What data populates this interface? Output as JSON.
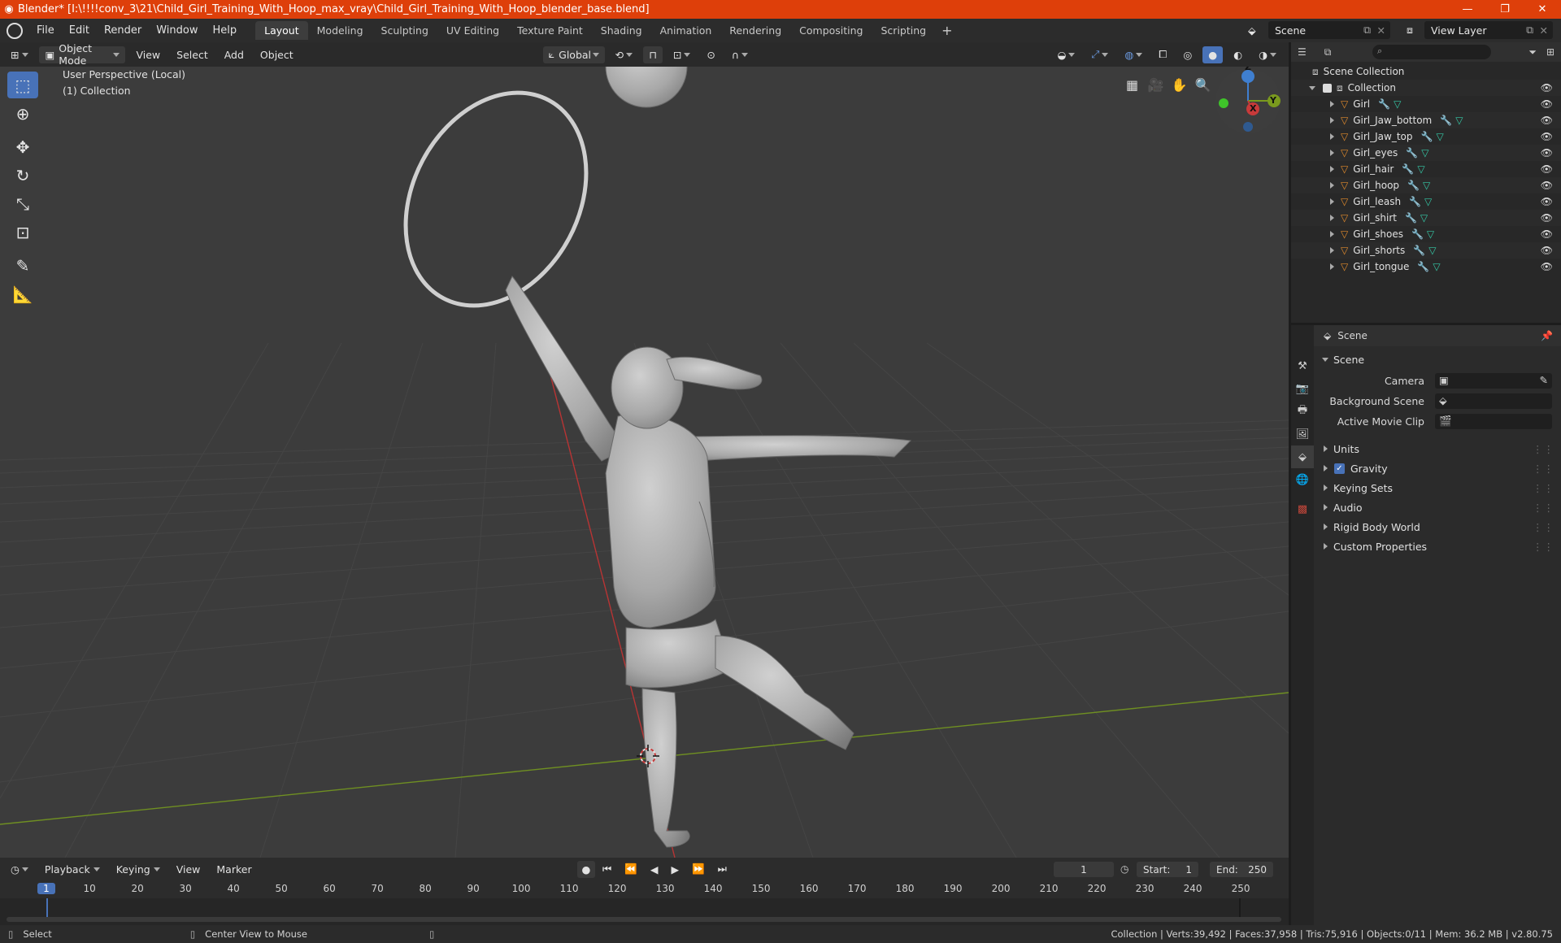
{
  "window": {
    "title": "Blender* [I:\\!!!!conv_3\\21\\Child_Girl_Training_With_Hoop_max_vray\\Child_Girl_Training_With_Hoop_blender_base.blend]",
    "minimize": "—",
    "maximize": "❐",
    "close": "✕"
  },
  "menu": [
    "File",
    "Edit",
    "Render",
    "Window",
    "Help"
  ],
  "workspaces": [
    "Layout",
    "Modeling",
    "Sculpting",
    "UV Editing",
    "Texture Paint",
    "Shading",
    "Animation",
    "Rendering",
    "Compositing",
    "Scripting"
  ],
  "active_workspace": "Layout",
  "scene_selector": "Scene",
  "view_layer_selector": "View Layer",
  "viewport_header": {
    "mode": "Object Mode",
    "menus": [
      "View",
      "Select",
      "Add",
      "Object"
    ],
    "orientation": "Global"
  },
  "viewport": {
    "perspective_label": "User Perspective (Local)",
    "collection_label": "(1) Collection"
  },
  "gizmo": {
    "x": "X",
    "y": "Y",
    "z": "Z"
  },
  "outliner": {
    "root": "Scene Collection",
    "collection": "Collection",
    "objects": [
      "Girl",
      "Girl_Jaw_bottom",
      "Girl_Jaw_top",
      "Girl_eyes",
      "Girl_hair",
      "Girl_hoop",
      "Girl_leash",
      "Girl_shirt",
      "Girl_shoes",
      "Girl_shorts",
      "Girl_tongue"
    ]
  },
  "properties": {
    "context": "Scene",
    "panel": "Scene",
    "fields": [
      {
        "label": "Camera"
      },
      {
        "label": "Background Scene"
      },
      {
        "label": "Active Movie Clip"
      }
    ],
    "subpanels": [
      "Units",
      "Gravity",
      "Keying Sets",
      "Audio",
      "Rigid Body World",
      "Custom Properties"
    ],
    "gravity_checked": true
  },
  "timeline": {
    "menus": [
      "Playback",
      "Keying",
      "View",
      "Marker"
    ],
    "current_frame": "1",
    "start_label": "Start:",
    "start": "1",
    "end_label": "End:",
    "end": "250",
    "ticks": [
      "1",
      "10",
      "20",
      "30",
      "40",
      "50",
      "60",
      "70",
      "80",
      "90",
      "100",
      "110",
      "120",
      "130",
      "140",
      "150",
      "160",
      "170",
      "180",
      "190",
      "200",
      "210",
      "220",
      "230",
      "240",
      "250"
    ]
  },
  "statusbar": {
    "left_action": "Select",
    "middle_action": "Center View to Mouse",
    "stats": "Collection | Verts:39,492 | Faces:37,958 | Tris:75,916 | Objects:0/11 | Mem: 36.2 MB | v2.80.75"
  },
  "colors": {
    "title_bar": "#de3f0a",
    "active_tool": "#4872b8",
    "x_axis": "#c83a3a",
    "y_axis": "#7a9a1e",
    "z_axis": "#3f7fd0",
    "object_orange": "#e08a2c",
    "mesh_teal": "#35c8a6",
    "modifier_blue": "#6b9ae0"
  }
}
